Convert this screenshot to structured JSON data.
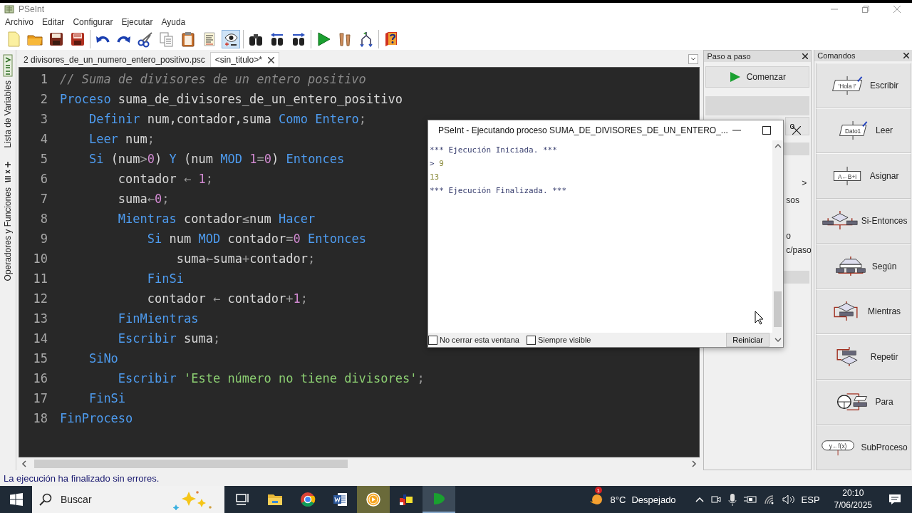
{
  "window": {
    "title": "PSeInt"
  },
  "menu": [
    "Archivo",
    "Editar",
    "Configurar",
    "Ejecutar",
    "Ayuda"
  ],
  "toolbar": {
    "groups": [
      [
        {
          "kind": "new",
          "pressed": false
        },
        {
          "kind": "open",
          "pressed": false
        },
        {
          "kind": "save",
          "pressed": false
        },
        {
          "kind": "save_as",
          "pressed": false
        }
      ],
      [
        {
          "kind": "undo",
          "pressed": false
        },
        {
          "kind": "redo",
          "pressed": false
        },
        {
          "kind": "cut",
          "pressed": false
        },
        {
          "kind": "copy",
          "pressed": false
        },
        {
          "kind": "paste",
          "pressed": false
        },
        {
          "kind": "list",
          "pressed": false
        },
        {
          "kind": "eye",
          "pressed": true
        }
      ],
      [
        {
          "kind": "binoculars",
          "pressed": false
        },
        {
          "kind": "find_prev",
          "pressed": false
        },
        {
          "kind": "find_next",
          "pressed": false
        }
      ],
      [
        {
          "kind": "run",
          "pressed": false
        },
        {
          "kind": "step",
          "pressed": false
        },
        {
          "kind": "flow",
          "pressed": false
        }
      ],
      [
        {
          "kind": "help",
          "pressed": false
        }
      ]
    ]
  },
  "side_panels": [
    {
      "kind": "variables",
      "label": "Lista de Variables"
    },
    {
      "kind": "operators",
      "label": "Operadores y Funciones"
    }
  ],
  "editor": {
    "tabs": [
      {
        "label": "2 divisores_de_un_numero_entero_positivo.psc",
        "selected": false,
        "closable": false
      },
      {
        "label": "<sin_titulo>*",
        "selected": true,
        "closable": true
      }
    ],
    "lines": [
      {
        "number": "1",
        "tokens": [
          {
            "kind": "comment",
            "text": "// Suma de divisores de un entero positivo"
          }
        ]
      },
      {
        "number": "2",
        "tokens": [
          {
            "kind": "keyword",
            "text": "Proceso"
          },
          {
            "kind": "ident",
            "text": " suma_de_divisores_de_un_entero_positivo"
          }
        ]
      },
      {
        "number": "3",
        "tokens": [
          {
            "kind": "keyword",
            "text": "    Definir"
          },
          {
            "kind": "ident",
            "text": " num,contador,suma "
          },
          {
            "kind": "keyword",
            "text": "Como Entero"
          },
          {
            "kind": "op",
            "text": ";"
          }
        ]
      },
      {
        "number": "4",
        "tokens": [
          {
            "kind": "keyword",
            "text": "    Leer"
          },
          {
            "kind": "ident",
            "text": " num"
          },
          {
            "kind": "op",
            "text": ";"
          }
        ]
      },
      {
        "number": "5",
        "tokens": [
          {
            "kind": "keyword",
            "text": "    Si"
          },
          {
            "kind": "ident",
            "text": " (num"
          },
          {
            "kind": "op",
            "text": ">"
          },
          {
            "kind": "number",
            "text": "0"
          },
          {
            "kind": "ident",
            "text": ") "
          },
          {
            "kind": "keyword",
            "text": "Y"
          },
          {
            "kind": "ident",
            "text": " (num "
          },
          {
            "kind": "keyword",
            "text": "MOD "
          },
          {
            "kind": "number",
            "text": "1"
          },
          {
            "kind": "op",
            "text": "="
          },
          {
            "kind": "number",
            "text": "0"
          },
          {
            "kind": "ident",
            "text": ") "
          },
          {
            "kind": "keyword",
            "text": "Entonces"
          }
        ]
      },
      {
        "number": "6",
        "tokens": [
          {
            "kind": "ident",
            "text": "        contador "
          },
          {
            "kind": "op",
            "text": "← "
          },
          {
            "kind": "number",
            "text": "1"
          },
          {
            "kind": "op",
            "text": ";"
          }
        ]
      },
      {
        "number": "7",
        "tokens": [
          {
            "kind": "ident",
            "text": "        suma"
          },
          {
            "kind": "op",
            "text": "←"
          },
          {
            "kind": "number",
            "text": "0"
          },
          {
            "kind": "op",
            "text": ";"
          }
        ]
      },
      {
        "number": "8",
        "tokens": [
          {
            "kind": "keyword",
            "text": "        Mientras"
          },
          {
            "kind": "ident",
            "text": " contador"
          },
          {
            "kind": "op",
            "text": "≤"
          },
          {
            "kind": "ident",
            "text": "num "
          },
          {
            "kind": "keyword",
            "text": "Hacer"
          }
        ]
      },
      {
        "number": "9",
        "tokens": [
          {
            "kind": "keyword",
            "text": "            Si"
          },
          {
            "kind": "ident",
            "text": " num "
          },
          {
            "kind": "keyword",
            "text": "MOD"
          },
          {
            "kind": "ident",
            "text": " contador"
          },
          {
            "kind": "op",
            "text": "="
          },
          {
            "kind": "number",
            "text": "0"
          },
          {
            "kind": "keyword",
            "text": " Entonces"
          }
        ]
      },
      {
        "number": "10",
        "tokens": [
          {
            "kind": "ident",
            "text": "                suma"
          },
          {
            "kind": "op",
            "text": "←"
          },
          {
            "kind": "ident",
            "text": "suma"
          },
          {
            "kind": "op",
            "text": "+"
          },
          {
            "kind": "ident",
            "text": "contador"
          },
          {
            "kind": "op",
            "text": ";"
          }
        ]
      },
      {
        "number": "11",
        "tokens": [
          {
            "kind": "keyword",
            "text": "            FinSi"
          }
        ]
      },
      {
        "number": "12",
        "tokens": [
          {
            "kind": "ident",
            "text": "            contador "
          },
          {
            "kind": "op",
            "text": "← "
          },
          {
            "kind": "ident",
            "text": "contador"
          },
          {
            "kind": "op",
            "text": "+"
          },
          {
            "kind": "number",
            "text": "1"
          },
          {
            "kind": "op",
            "text": ";"
          }
        ]
      },
      {
        "number": "13",
        "tokens": [
          {
            "kind": "keyword",
            "text": "        FinMientras"
          }
        ]
      },
      {
        "number": "14",
        "tokens": [
          {
            "kind": "keyword",
            "text": "        Escribir"
          },
          {
            "kind": "ident",
            "text": " suma"
          },
          {
            "kind": "op",
            "text": ";"
          }
        ]
      },
      {
        "number": "15",
        "tokens": [
          {
            "kind": "keyword",
            "text": "    SiNo"
          }
        ]
      },
      {
        "number": "16",
        "tokens": [
          {
            "kind": "keyword",
            "text": "        Escribir"
          },
          {
            "kind": "string",
            "text": " 'Este número no tiene divisores'"
          },
          {
            "kind": "op",
            "text": ";"
          }
        ]
      },
      {
        "number": "17",
        "tokens": [
          {
            "kind": "keyword",
            "text": "    FinSi"
          }
        ]
      },
      {
        "number": "18",
        "tokens": [
          {
            "kind": "keyword",
            "text": "FinProceso"
          }
        ]
      }
    ]
  },
  "step_panel": {
    "title": "Paso a paso",
    "items": [
      {
        "kind": "button",
        "label": "Comenzar"
      },
      {
        "kind": "blank"
      },
      {
        "kind": "button_fragment",
        "text": "o"
      },
      {
        "kind": "bar"
      },
      {
        "kind": "chevron",
        "text": ">"
      },
      {
        "kind": "fragment",
        "text": "sos"
      },
      {
        "kind": "fragment",
        "text": "o"
      },
      {
        "kind": "fragment",
        "text": "c/paso"
      },
      {
        "kind": "bar"
      }
    ]
  },
  "commands_panel": {
    "title": "Comandos",
    "items": [
      {
        "kind": "escribir",
        "label": "Escribir",
        "icon_text": "'Hola !'"
      },
      {
        "kind": "leer",
        "label": "Leer",
        "icon_text": "Dato1"
      },
      {
        "kind": "asignar",
        "label": "Asignar",
        "icon_text": "A←B+i"
      },
      {
        "kind": "si",
        "label": "Si-Entonces"
      },
      {
        "kind": "segun",
        "label": "Según"
      },
      {
        "kind": "mientras",
        "label": "Mientras"
      },
      {
        "kind": "repetir",
        "label": "Repetir"
      },
      {
        "kind": "para",
        "label": "Para"
      },
      {
        "kind": "subproceso",
        "label": "SubProceso",
        "icon_text": "y←f(x)"
      }
    ]
  },
  "console": {
    "title": "PSeInt - Ejecutando proceso SUMA_DE_DIVISORES_DE_UN_ENTERO_...",
    "lines": [
      {
        "kind": "info",
        "text": "*** Ejecución Iniciada. ***"
      },
      {
        "kind": "input",
        "prompt": ">",
        "text": "9"
      },
      {
        "kind": "output",
        "text": "13"
      },
      {
        "kind": "info",
        "text": "*** Ejecución Finalizada. ***"
      }
    ],
    "options": [
      {
        "label": "No cerrar esta ventana",
        "checked": false
      },
      {
        "label": "Siempre visible",
        "checked": false
      }
    ],
    "button": "Reiniciar"
  },
  "status_bar": "La ejecución ha finalizado sin errores.",
  "taskbar": {
    "search": {
      "placeholder": "Buscar"
    },
    "apps": [
      {
        "kind": "taskview",
        "selected": false,
        "hovered": false
      },
      {
        "kind": "explorer",
        "selected": false,
        "hovered": false
      },
      {
        "kind": "chrome",
        "selected": false,
        "hovered": false
      },
      {
        "kind": "word",
        "selected": false,
        "hovered": false
      },
      {
        "kind": "media",
        "selected": false,
        "hovered": true
      },
      {
        "kind": "office",
        "selected": false,
        "hovered": false
      },
      {
        "kind": "pseint",
        "selected": true,
        "hovered": false
      }
    ],
    "weather": {
      "badge": "1",
      "temperature": "8°C",
      "condition": "Despejado"
    },
    "language": "ESP",
    "time": "20:10",
    "date": "7/06/2025"
  }
}
